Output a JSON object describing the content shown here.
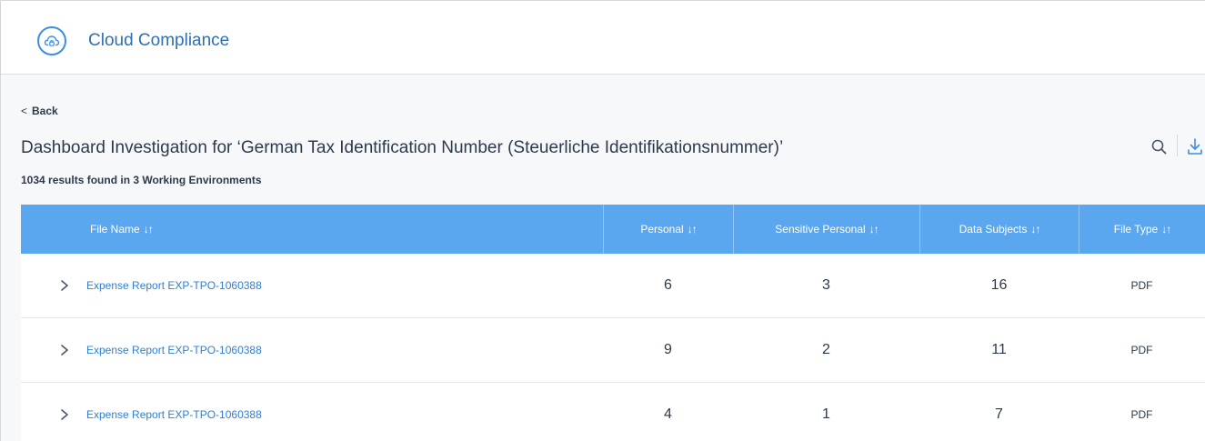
{
  "header": {
    "app_title": "Cloud Compliance",
    "app_icon": "cloud-lock-icon",
    "accent_color": "#3b8ee6"
  },
  "nav": {
    "back_label": "Back",
    "back_icon": "chevron-left-icon"
  },
  "page": {
    "title": "Dashboard Investigation for ‘German Tax Identification Number (Steuerliche Identifikationsnummer)’",
    "results_summary": "1034 results found in 3 Working Environments"
  },
  "toolbar": {
    "search_icon": "search-icon",
    "download_icon": "download-icon"
  },
  "table": {
    "header_color": "#5aa7ef",
    "sort_indicator": "↓↑",
    "columns": {
      "file_name": "File Name",
      "personal": "Personal",
      "sensitive_personal": "Sensitive Personal",
      "data_subjects": "Data Subjects",
      "file_type": "File Type"
    },
    "rows": [
      {
        "file_name": "Expense Report EXP-TPO-1060388",
        "personal": "6",
        "sensitive_personal": "3",
        "data_subjects": "16",
        "file_type": "PDF"
      },
      {
        "file_name": "Expense Report EXP-TPO-1060388",
        "personal": "9",
        "sensitive_personal": "2",
        "data_subjects": "11",
        "file_type": "PDF"
      },
      {
        "file_name": "Expense Report EXP-TPO-1060388",
        "personal": "4",
        "sensitive_personal": "1",
        "data_subjects": "7",
        "file_type": "PDF"
      }
    ]
  }
}
